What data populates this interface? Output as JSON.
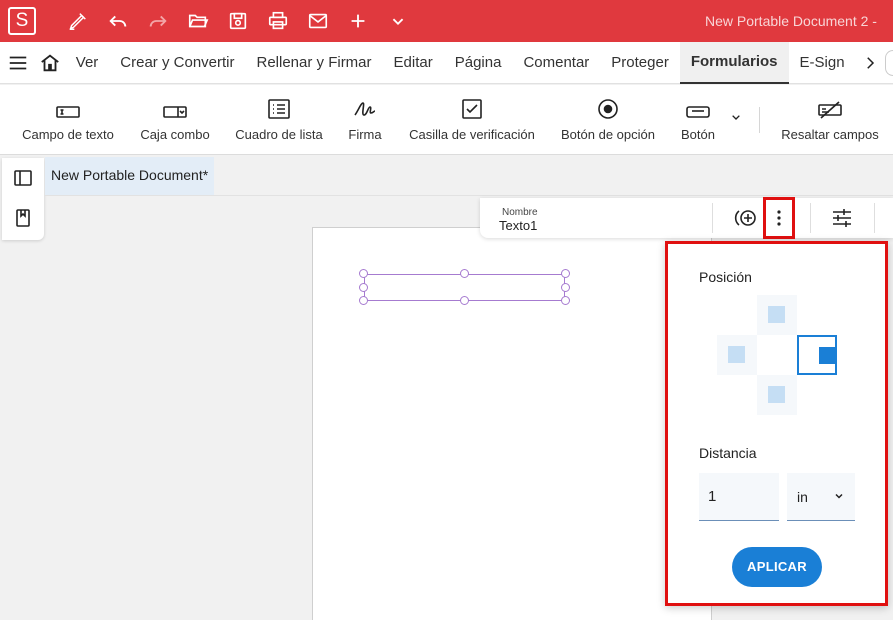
{
  "titlebar": {
    "app_logo": "S",
    "window_title": "New Portable Document 2  -",
    "quick_access": [
      "pen-icon",
      "undo-icon",
      "redo-icon",
      "open-folder-icon",
      "save-icon",
      "print-icon",
      "mail-icon",
      "plus-icon",
      "chevron-down-icon"
    ],
    "color": "#e0393e"
  },
  "menubar": {
    "items": [
      {
        "label": "Ver"
      },
      {
        "label": "Crear y Convertir"
      },
      {
        "label": "Rellenar y Firmar"
      },
      {
        "label": "Editar"
      },
      {
        "label": "Página"
      },
      {
        "label": "Comentar"
      },
      {
        "label": "Proteger"
      },
      {
        "label": "Formularios",
        "active": true
      },
      {
        "label": "E-Sign"
      }
    ]
  },
  "ribbon": {
    "tools": [
      {
        "label": "Campo de texto",
        "icon": "text-field-icon"
      },
      {
        "label": "Caja combo",
        "icon": "combo-box-icon"
      },
      {
        "label": "Cuadro de lista",
        "icon": "list-box-icon"
      },
      {
        "label": "Firma",
        "icon": "signature-icon"
      },
      {
        "label": "Casilla de verificación",
        "icon": "checkbox-icon"
      },
      {
        "label": "Botón de opción",
        "icon": "radio-button-icon"
      },
      {
        "label": "Botón",
        "icon": "button-icon"
      },
      {
        "label": "Resaltar campos",
        "icon": "highlight-fields-icon"
      }
    ]
  },
  "document": {
    "tab_label": "New Portable Document*"
  },
  "field_bar": {
    "name_label": "Nombre",
    "name_value": "Texto1"
  },
  "position_popup": {
    "title": "Posición",
    "selected_position": "right",
    "distance_label": "Distancia",
    "distance_value": "1",
    "unit": "in",
    "apply_label": "APLICAR"
  },
  "colors": {
    "accent": "#1a7fd6",
    "highlight": "#e01010",
    "field_outline": "#a67bd0"
  }
}
